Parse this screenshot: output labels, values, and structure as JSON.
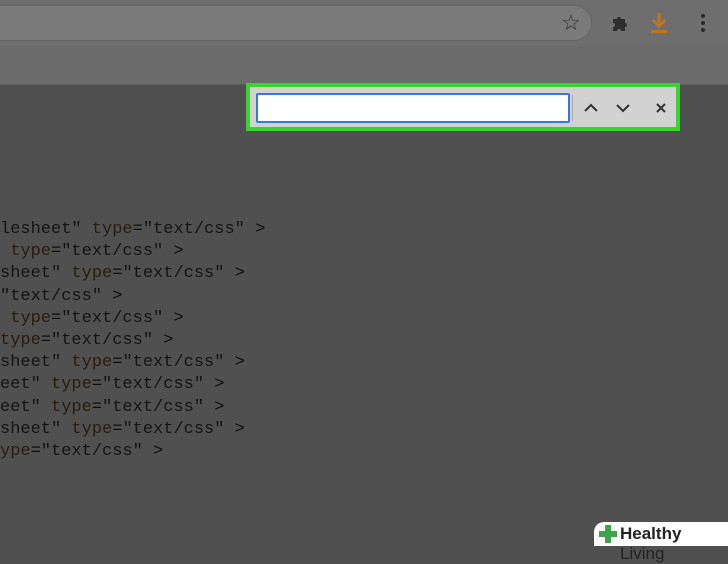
{
  "toolbar": {
    "icons": [
      "star-icon",
      "extensions-icon",
      "download-icon",
      "menu-icon"
    ]
  },
  "find_bar": {
    "input_value": ""
  },
  "code": {
    "lines": [
      [
        {
          "t": "lesheet\"",
          "c": "s"
        },
        {
          "t": " ",
          "c": "p"
        },
        {
          "t": "type",
          "c": "a"
        },
        {
          "t": "=",
          "c": "p"
        },
        {
          "t": "\"text/css\"",
          "c": "s"
        },
        {
          "t": " >",
          "c": "p"
        }
      ],
      [
        {
          "t": " ",
          "c": "p"
        },
        {
          "t": "type",
          "c": "a"
        },
        {
          "t": "=",
          "c": "p"
        },
        {
          "t": "\"text/css\"",
          "c": "s"
        },
        {
          "t": " >",
          "c": "p"
        }
      ],
      [
        {
          "t": "sheet\"",
          "c": "s"
        },
        {
          "t": " ",
          "c": "p"
        },
        {
          "t": "type",
          "c": "a"
        },
        {
          "t": "=",
          "c": "p"
        },
        {
          "t": "\"text/css\"",
          "c": "s"
        },
        {
          "t": " >",
          "c": "p"
        }
      ],
      [
        {
          "t": "\"text/css\"",
          "c": "s"
        },
        {
          "t": " >",
          "c": "p"
        }
      ],
      [
        {
          "t": " ",
          "c": "p"
        },
        {
          "t": "type",
          "c": "a"
        },
        {
          "t": "=",
          "c": "p"
        },
        {
          "t": "\"text/css\"",
          "c": "s"
        },
        {
          "t": " >",
          "c": "p"
        }
      ],
      [
        {
          "t": "type",
          "c": "a"
        },
        {
          "t": "=",
          "c": "p"
        },
        {
          "t": "\"text/css\"",
          "c": "s"
        },
        {
          "t": " >",
          "c": "p"
        }
      ],
      [
        {
          "t": "sheet\"",
          "c": "s"
        },
        {
          "t": " ",
          "c": "p"
        },
        {
          "t": "type",
          "c": "a"
        },
        {
          "t": "=",
          "c": "p"
        },
        {
          "t": "\"text/css\"",
          "c": "s"
        },
        {
          "t": " >",
          "c": "p"
        }
      ],
      [
        {
          "t": "eet\"",
          "c": "s"
        },
        {
          "t": " ",
          "c": "p"
        },
        {
          "t": "type",
          "c": "a"
        },
        {
          "t": "=",
          "c": "p"
        },
        {
          "t": "\"text/css\"",
          "c": "s"
        },
        {
          "t": " >",
          "c": "p"
        }
      ],
      [
        {
          "t": "eet\"",
          "c": "s"
        },
        {
          "t": " ",
          "c": "p"
        },
        {
          "t": "type",
          "c": "a"
        },
        {
          "t": "=",
          "c": "p"
        },
        {
          "t": "\"text/css\"",
          "c": "s"
        },
        {
          "t": " >",
          "c": "p"
        }
      ],
      [
        {
          "t": "sheet\"",
          "c": "s"
        },
        {
          "t": " ",
          "c": "p"
        },
        {
          "t": "type",
          "c": "a"
        },
        {
          "t": "=",
          "c": "p"
        },
        {
          "t": "\"text/css\"",
          "c": "s"
        },
        {
          "t": " >",
          "c": "p"
        }
      ],
      [
        {
          "t": "ype",
          "c": "a"
        },
        {
          "t": "=",
          "c": "p"
        },
        {
          "t": "\"text/css\"",
          "c": "s"
        },
        {
          "t": " >",
          "c": "p"
        }
      ]
    ]
  },
  "watermark": {
    "brand_bold": "Healthy",
    "brand_light": " Living",
    "brand_color": "#3aa54a"
  },
  "colors": {
    "highlight": "#39d52f",
    "input_focus": "#2f7be0",
    "download": "#c0751e"
  }
}
